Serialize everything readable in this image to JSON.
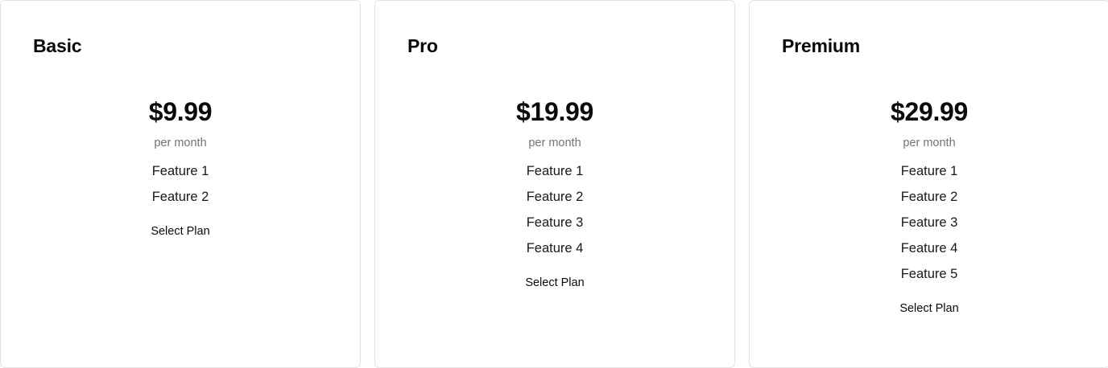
{
  "plans": [
    {
      "name": "Basic",
      "price": "$9.99",
      "period": "per month",
      "features": [
        "Feature 1",
        "Feature 2"
      ],
      "button_label": "Select Plan"
    },
    {
      "name": "Pro",
      "price": "$19.99",
      "period": "per month",
      "features": [
        "Feature 1",
        "Feature 2",
        "Feature 3",
        "Feature 4"
      ],
      "button_label": "Select Plan"
    },
    {
      "name": "Premium",
      "price": "$29.99",
      "period": "per month",
      "features": [
        "Feature 1",
        "Feature 2",
        "Feature 3",
        "Feature 4",
        "Feature 5"
      ],
      "button_label": "Select Plan"
    }
  ],
  "colors": {
    "border": "#e4e4e7",
    "muted_text": "#71717a",
    "text": "#0a0a0a"
  }
}
